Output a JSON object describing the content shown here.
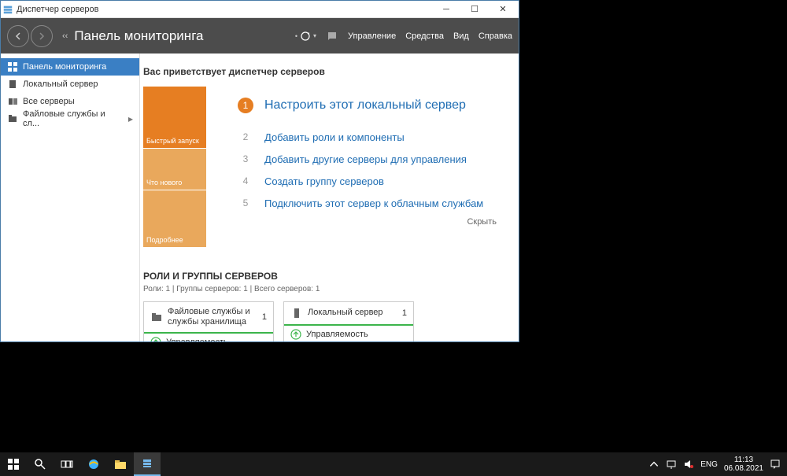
{
  "window": {
    "title": "Диспетчер серверов"
  },
  "header": {
    "breadcrumb_sep": "‹‹",
    "page_title": "Панель мониторинга",
    "menu": [
      "Управление",
      "Средства",
      "Вид",
      "Справка"
    ]
  },
  "sidebar": {
    "items": [
      {
        "label": "Панель мониторинга",
        "icon": "dashboard",
        "active": true
      },
      {
        "label": "Локальный сервер",
        "icon": "server"
      },
      {
        "label": "Все серверы",
        "icon": "servers"
      },
      {
        "label": "Файловые службы и сл...",
        "icon": "files",
        "chevron": true
      }
    ]
  },
  "welcome_title": "Вас приветствует диспетчер серверов",
  "quick_tiles": [
    {
      "label": "Быстрый запуск"
    },
    {
      "label": "Что нового"
    },
    {
      "label": "Подробнее"
    }
  ],
  "steps": [
    {
      "num": "1",
      "label": "Настроить этот локальный сервер",
      "primary": true
    },
    {
      "num": "2",
      "label": "Добавить роли и компоненты"
    },
    {
      "num": "3",
      "label": "Добавить другие серверы для управления"
    },
    {
      "num": "4",
      "label": "Создать группу серверов"
    },
    {
      "num": "5",
      "label": "Подключить этот сервер к облачным службам"
    }
  ],
  "hide_label": "Скрыть",
  "roles": {
    "title": "РОЛИ И ГРУППЫ СЕРВЕРОВ",
    "subtitle": "Роли: 1 | Группы серверов: 1 | Всего серверов: 1"
  },
  "cards": [
    {
      "name": "Файловые службы и службы хранилища",
      "count": "1",
      "row1": "Управляемость"
    },
    {
      "name": "Локальный сервер",
      "count": "1",
      "row1": "Управляемость"
    }
  ],
  "taskbar": {
    "lang": "ENG",
    "time": "11:13",
    "date": "06.08.2021"
  }
}
